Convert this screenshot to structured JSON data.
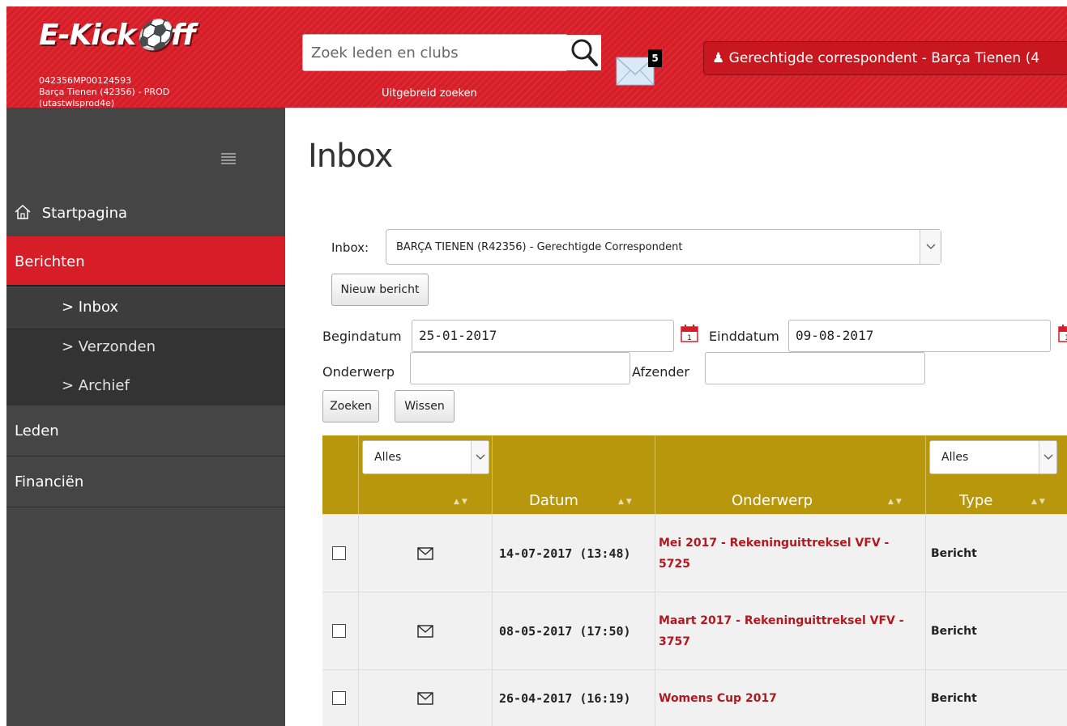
{
  "header": {
    "logo_text": "E-Kick⚽ff",
    "account_code": "042356MP00124593",
    "club_line": "Barça Tienen (42356) - PROD",
    "env_line": "(utastwlsprod4e)",
    "search_placeholder": "Zoek leden en clubs",
    "advanced_search_label": "Uitgebreid zoeken",
    "mail_count": "5",
    "role_label": "Gerechtigde correspondent - Barça Tienen (4",
    "role_icon": "user-icon",
    "brand_color": "#d71e28"
  },
  "sidebar": {
    "home_label": "Startpagina",
    "berichten_label": "Berichten",
    "subitems": [
      {
        "label": "> Inbox",
        "active": true
      },
      {
        "label": "> Verzonden",
        "active": false
      },
      {
        "label": "> Archief",
        "active": false
      }
    ],
    "leden_label": "Leden",
    "financien_label": "Financiën"
  },
  "main": {
    "title": "Inbox",
    "inbox_label": "Inbox:",
    "inbox_selected": "BARÇA TIENEN (R42356) - Gerechtigde Correspondent",
    "new_message_label": "Nieuw bericht",
    "begin_label": "Begindatum",
    "begin_value": "25-01-2017",
    "end_label": "Einddatum",
    "end_value": "09-08-2017",
    "subject_label": "Onderwerp",
    "subject_value": "",
    "sender_label": "Afzender",
    "sender_value": "",
    "search_label": "Zoeken",
    "clear_label": "Wissen"
  },
  "table": {
    "header_color": "#b8970c",
    "status_filter": "Alles",
    "type_filter": "Alles",
    "columns": [
      "",
      "",
      "Datum",
      "Onderwerp",
      "Type"
    ],
    "rows": [
      {
        "date": "14-07-2017 (13:48)",
        "subject": "Mei 2017 - Rekeninguittreksel VFV - 5725",
        "type": "Bericht"
      },
      {
        "date": "08-05-2017 (17:50)",
        "subject": "Maart 2017 - Rekeninguittreksel VFV - 3757",
        "type": "Bericht"
      },
      {
        "date": "26-04-2017 (16:19)",
        "subject": "Womens Cup 2017",
        "type": "Bericht"
      }
    ]
  }
}
